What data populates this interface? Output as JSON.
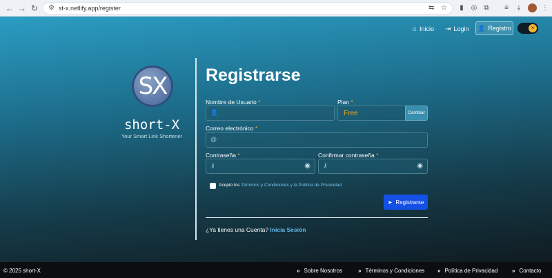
{
  "browser": {
    "url": "st-x.netlify.app/register",
    "tune_icon": "tune-icon",
    "translate_icon": "translate-icon",
    "star_icon": "star-icon"
  },
  "nav": {
    "inicio": "Inicio",
    "login": "Login",
    "registro": "Registro",
    "theme_toggle_icon": "sun-icon"
  },
  "brand": {
    "logo_text": "SX",
    "name": "short-X",
    "tagline": "Your Smart Link Shortener"
  },
  "form": {
    "title": "Registrarse",
    "username_label": "Nombre de Usuario",
    "plan_label": "Plan",
    "plan_value": "Free",
    "change_plan_button": "Cambiar",
    "email_label": "Correo electrónico",
    "password_label": "Contraseña",
    "confirm_password_label": "Confirmar contraseña",
    "required_marker": "*",
    "accept_prefix": "Acepto los",
    "terms_link": "Términos y Condiciones",
    "and": "y la",
    "privacy_link": "Política de Privacidad",
    "submit_button": "Registrarse",
    "have_account": "¿Ya tienes una Cuenta?",
    "login_link": "Inicia Sesión"
  },
  "footer": {
    "copyright": "© 2025 short-X",
    "links": [
      "Sobre Nosotros",
      "Términos y Condiciones",
      "Política de Privacidad",
      "Contacto"
    ]
  },
  "colors": {
    "accent_blue": "#1450e6",
    "required": "#f2b13a",
    "plan_value": "#f2a62a",
    "link": "#5fb8ec"
  }
}
